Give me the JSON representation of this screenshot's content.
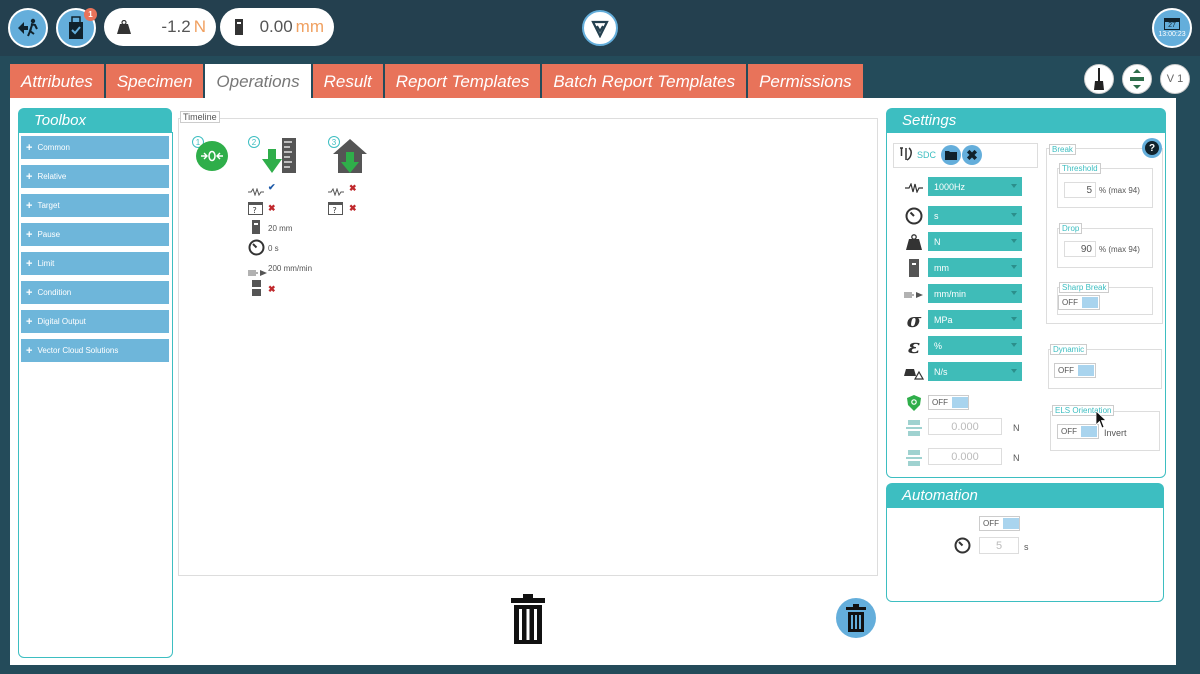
{
  "topbar": {
    "exit_icon": "exit-run-icon",
    "usb_icon": "usb-check-icon",
    "usb_badge": "1",
    "force": {
      "value": "-1.2",
      "unit": "N"
    },
    "position": {
      "value": "0.00",
      "unit": "mm"
    },
    "calendar": {
      "day": "27",
      "time": "13:00:23"
    }
  },
  "tabs": [
    "Attributes",
    "Specimen",
    "Operations",
    "Result",
    "Report Templates",
    "Batch Report Templates",
    "Permissions"
  ],
  "active_tab": "Operations",
  "right_tools": {
    "version": "V 1"
  },
  "toolbox": {
    "title": "Toolbox",
    "items": [
      "Common",
      "Relative",
      "Target",
      "Pause",
      "Limit",
      "Condition",
      "Digital Output",
      "Vector Cloud Solutions"
    ]
  },
  "timeline": {
    "label": "Timeline",
    "steps": [
      "1",
      "2",
      "3"
    ],
    "step2": {
      "distance": "20 mm",
      "time": "0 s",
      "speed": "200 mm/min"
    }
  },
  "settings": {
    "title": "Settings",
    "sdc_label": "SDC",
    "selects": [
      "1000Hz",
      "s",
      "N",
      "mm",
      "mm/min",
      "MPa",
      "%",
      "N/s"
    ],
    "protect_toggle": "OFF",
    "limit1": {
      "value": "0.000",
      "unit": "N"
    },
    "limit2": {
      "value": "0.000",
      "unit": "N"
    },
    "break": {
      "legend": "Break",
      "threshold": {
        "legend": "Threshold",
        "value": "5",
        "suffix": "% (max 94)"
      },
      "drop": {
        "legend": "Drop",
        "value": "90",
        "suffix": "% (max 94)"
      },
      "sharp_break": {
        "legend": "Sharp Break",
        "toggle": "OFF"
      }
    },
    "dynamic": {
      "legend": "Dynamic",
      "toggle": "OFF"
    },
    "els": {
      "legend": "ELS Orientation",
      "toggle": "OFF",
      "invert": "Invert"
    }
  },
  "automation": {
    "title": "Automation",
    "toggle": "OFF",
    "value": "5",
    "unit": "s"
  },
  "colors": {
    "teal": "#3dbec1",
    "orange": "#e8735a",
    "blue": "#64aedb",
    "dark": "#24404f"
  }
}
